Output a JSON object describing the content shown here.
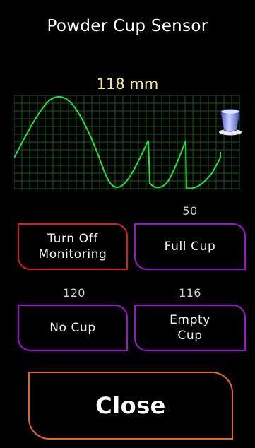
{
  "title": "Powder Cup Sensor",
  "reading": "118 mm",
  "colors": {
    "reading": "#f3e98a",
    "trace": "#1fe13a",
    "grid": "#125c12",
    "border_purple": "#a010d8",
    "border_red": "#e01b1b",
    "border_orange": "#e8661a"
  },
  "graph": {
    "icon": "powder-cup-icon",
    "grid": true
  },
  "buttons": {
    "turn_off_monitoring": "Turn Off\nMonitoring",
    "full_cup": "Full Cup",
    "no_cup": "No Cup",
    "empty_cup": "Empty\nCup",
    "close": "Close"
  },
  "values": {
    "full_cup": "50",
    "no_cup": "120",
    "empty_cup": "116"
  }
}
